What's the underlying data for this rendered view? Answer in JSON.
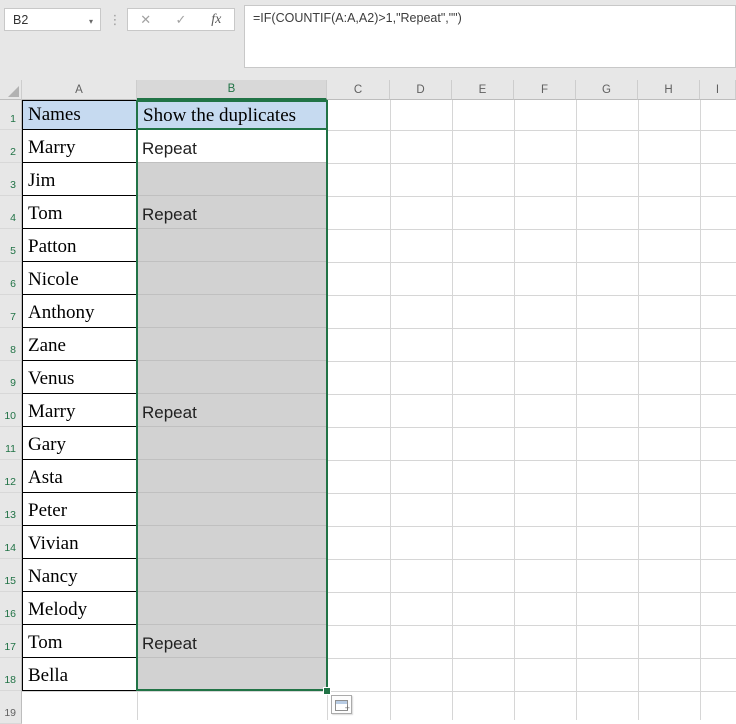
{
  "name_box": {
    "value": "B2"
  },
  "icons": {
    "dropdown": "▾",
    "more_options": "⋮"
  },
  "formula_buttons": {
    "cancel": "✕",
    "confirm": "✓",
    "function": "fx"
  },
  "formula_bar": {
    "text": "=IF(COUNTIF(A:A,A2)>1,\"Repeat\",\"\")"
  },
  "sheet": {
    "column_headers": [
      "A",
      "B",
      "C",
      "D",
      "E",
      "F",
      "G",
      "H",
      "I"
    ],
    "selected_column": "B",
    "selection": {
      "range": "B2:B18",
      "active_cell": "B2"
    },
    "visible_rows": 19,
    "columns": {
      "a_header": "Names",
      "b_header": "Show the duplicates"
    },
    "rows": [
      {
        "n": 2,
        "name": "Marry",
        "result": "Repeat"
      },
      {
        "n": 3,
        "name": "Jim",
        "result": ""
      },
      {
        "n": 4,
        "name": "Tom",
        "result": "Repeat"
      },
      {
        "n": 5,
        "name": "Patton",
        "result": ""
      },
      {
        "n": 6,
        "name": "Nicole",
        "result": ""
      },
      {
        "n": 7,
        "name": "Anthony",
        "result": ""
      },
      {
        "n": 8,
        "name": "Zane",
        "result": ""
      },
      {
        "n": 9,
        "name": "Venus",
        "result": ""
      },
      {
        "n": 10,
        "name": "Marry",
        "result": "Repeat"
      },
      {
        "n": 11,
        "name": "Gary",
        "result": ""
      },
      {
        "n": 12,
        "name": "Asta",
        "result": ""
      },
      {
        "n": 13,
        "name": "Peter",
        "result": ""
      },
      {
        "n": 14,
        "name": "Vivian",
        "result": ""
      },
      {
        "n": 15,
        "name": "Nancy",
        "result": ""
      },
      {
        "n": 16,
        "name": "Melody",
        "result": ""
      },
      {
        "n": 17,
        "name": "Tom",
        "result": "Repeat"
      },
      {
        "n": 18,
        "name": "Bella",
        "result": ""
      }
    ]
  },
  "colors": {
    "selection_green": "#217346",
    "header_fill_blue": "#c6daf0",
    "selection_gray": "#d2d2d2",
    "chrome_gray": "#e7e7e7"
  }
}
